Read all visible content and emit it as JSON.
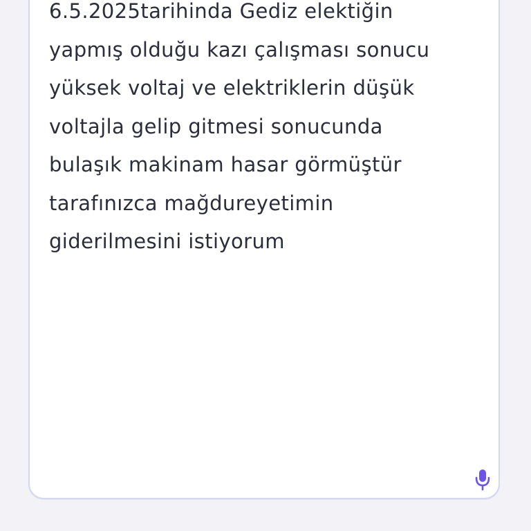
{
  "complaint_form": {
    "description_text": "6.5.2025tarihinda Gediz elektiğin\nyapmış olduğu kazı çalışması sonucu\nyüksek voltaj ve elektriklerin düşük\nvoltajla gelip gitmesi sonucunda\nbulaşık makinam hasar görmüştür\ntarafınızca mağdureyetimin\ngiderilmesini istiyorum",
    "mic_icon": "microphone-icon"
  },
  "colors": {
    "background": "#f3f3f7",
    "card": "#ffffff",
    "border": "#d4d7ee",
    "text": "#2c2d3a",
    "accent": "#6c55e6"
  }
}
